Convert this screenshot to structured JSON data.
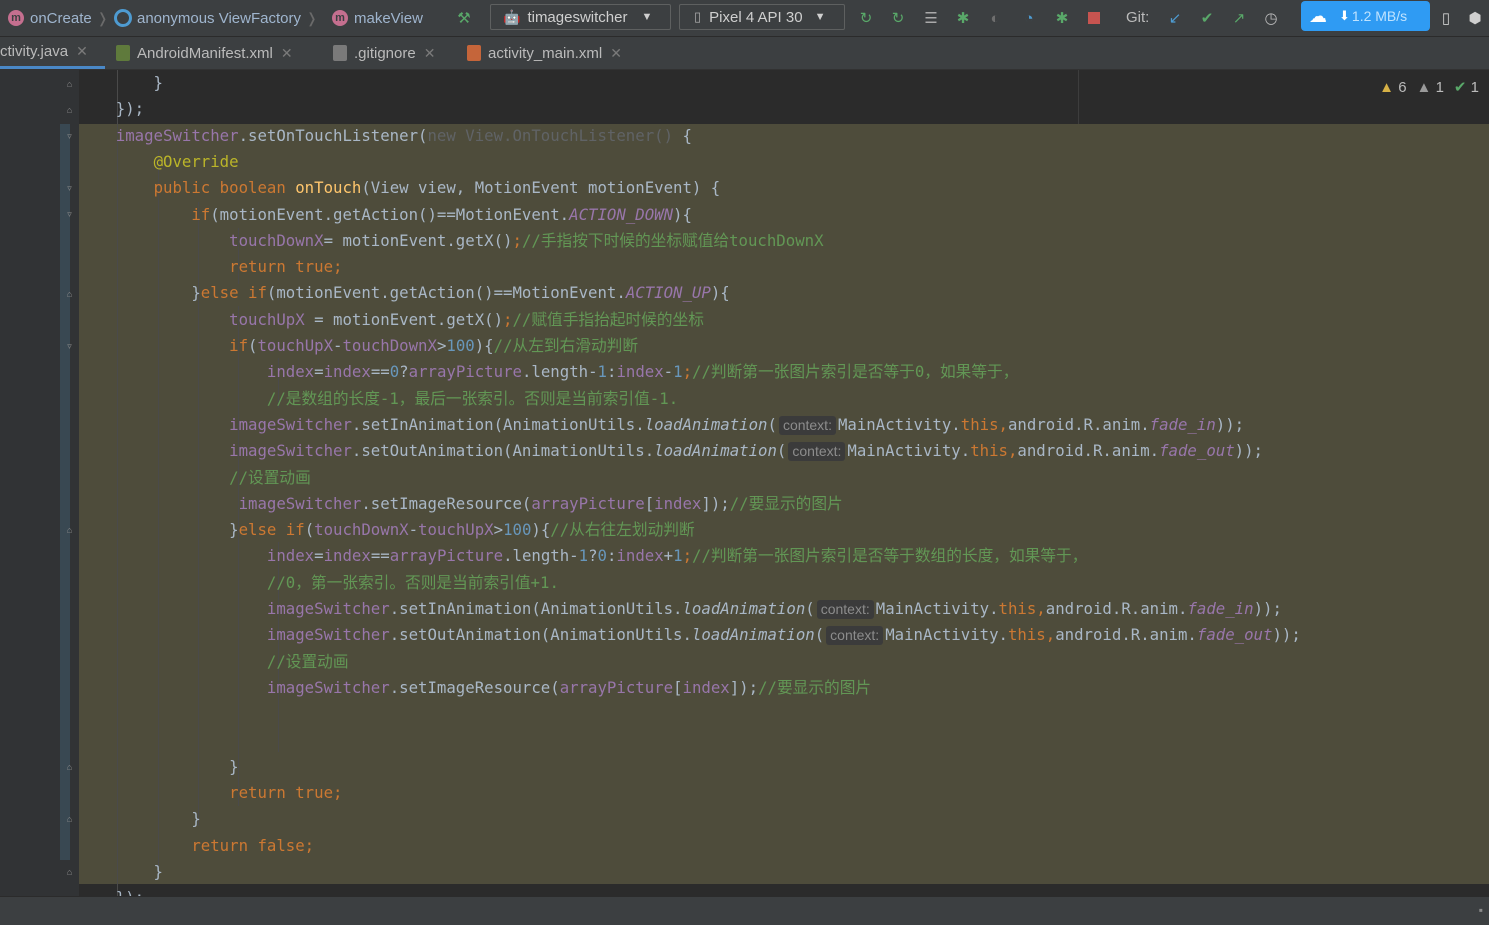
{
  "breadcrumbs": [
    {
      "badge": "m",
      "label": "onCreate"
    },
    {
      "badge": "",
      "label": "anonymous ViewFactory"
    },
    {
      "badge": "m",
      "label": "makeView"
    }
  ],
  "toolbar": {
    "run_config": "timageswitcher",
    "device": "Pixel 4 API 30",
    "git_label": "Git:",
    "net_speed": "1.2 MB/s"
  },
  "tabs": [
    {
      "label": "ctivity.java",
      "active": true
    },
    {
      "label": "AndroidManifest.xml",
      "active": false
    },
    {
      "label": ".gitignore",
      "active": false
    },
    {
      "label": "activity_main.xml",
      "active": false
    }
  ],
  "inspections": {
    "warnings": "6",
    "weak_warnings": "1",
    "typos": "1"
  },
  "hint_label": "context:",
  "code": [
    [
      "        }"
    ],
    [
      "    });"
    ],
    [
      "    imageSwitcher",
      ".setOnTouchListener(",
      "new View.OnTouchListener()",
      " {"
    ],
    [
      "        ",
      "@Override"
    ],
    [
      "        ",
      "public boolean ",
      "onTouch",
      "(View view, MotionEvent motionEvent) {"
    ],
    [
      "            ",
      "if",
      "(motionEvent.getAction()==MotionEvent.",
      "ACTION_DOWN",
      "){"
    ],
    [
      "                ",
      "touchDownX",
      "= motionEvent.getX()",
      ";",
      "//手指按下时候的坐标赋值给touchDownX"
    ],
    [
      "                ",
      "return true;"
    ],
    [
      "            }",
      "else if",
      "(motionEvent.getAction()==MotionEvent.",
      "ACTION_UP",
      "){"
    ],
    [
      "                ",
      "touchUpX",
      " = motionEvent.getX()",
      ";",
      "//赋值手指抬起时候的坐标"
    ],
    [
      "                ",
      "if",
      "(",
      "touchUpX",
      "-",
      "touchDownX",
      ">",
      "100",
      "){",
      "//从左到右滑动判断"
    ],
    [
      "                    ",
      "index",
      "=",
      "index",
      "==",
      "0",
      "?",
      "arrayPicture",
      ".length-",
      "1",
      ":",
      "index",
      "-",
      "1",
      ";",
      "//判断第一张图片索引是否等于0，如果等于，"
    ],
    [
      "                    ",
      "//是数组的长度-1，最后一张索引。否则是当前索引值-1."
    ],
    [
      "                ",
      "imageSwitcher",
      ".setInAnimation(AnimationUtils.",
      "loadAnimation",
      "(",
      "MainActivity.",
      "this,",
      "android.R.anim.",
      "fade_in",
      "));"
    ],
    [
      "                ",
      "imageSwitcher",
      ".setOutAnimation(AnimationUtils.",
      "loadAnimation",
      "(",
      "MainActivity.",
      "this,",
      "android.R.anim.",
      "fade_out",
      "));"
    ],
    [
      "                ",
      "//设置动画"
    ],
    [
      "                 ",
      "imageSwitcher",
      ".setImageResource(",
      "arrayPicture",
      "[",
      "index",
      "]);",
      "//要显示的图片"
    ],
    [
      "                }",
      "else if",
      "(",
      "touchDownX",
      "-",
      "touchUpX",
      ">",
      "100",
      "){",
      "//从右往左划动判断"
    ],
    [
      "                    ",
      "index",
      "=",
      "index",
      "==",
      "arrayPicture",
      ".length-",
      "1",
      "?",
      "0",
      ":",
      "index",
      "+",
      "1",
      ";",
      "//判断第一张图片索引是否等于数组的长度，如果等于，"
    ],
    [
      "                    ",
      "//0，第一张索引。否则是当前索引值+1."
    ],
    [
      "                    ",
      "imageSwitcher",
      ".setInAnimation(AnimationUtils.",
      "loadAnimation",
      "(",
      "MainActivity.",
      "this,",
      "android.R.anim.",
      "fade_in",
      "));"
    ],
    [
      "                    ",
      "imageSwitcher",
      ".setOutAnimation(AnimationUtils.",
      "loadAnimation",
      "(",
      "MainActivity.",
      "this,",
      "android.R.anim.",
      "fade_out",
      "));"
    ],
    [
      "                    ",
      "//设置动画"
    ],
    [
      "                    ",
      "imageSwitcher",
      ".setImageResource(",
      "arrayPicture",
      "[",
      "index",
      "]);",
      "//要显示的图片"
    ],
    [
      ""
    ],
    [
      ""
    ],
    [
      "                }"
    ],
    [
      "                ",
      "return true;"
    ],
    [
      "            }"
    ],
    [
      "            ",
      "return false;"
    ],
    [
      "        }"
    ],
    [
      "    });"
    ]
  ],
  "code_styles": [
    [
      "p"
    ],
    [
      "p"
    ],
    [
      "fld",
      "p",
      "dim",
      "p"
    ],
    [
      "p",
      "ann"
    ],
    [
      "p",
      "kw",
      "mth",
      "p"
    ],
    [
      "p",
      "kw",
      "p",
      "fldi",
      "p"
    ],
    [
      "p",
      "fld",
      "p",
      "kw",
      "cmt"
    ],
    [
      "p",
      "kw"
    ],
    [
      "p",
      "kw",
      "p",
      "fldi",
      "p"
    ],
    [
      "p",
      "fld",
      "p",
      "kw",
      "cmt"
    ],
    [
      "p",
      "kw",
      "p",
      "fld",
      "p",
      "fld",
      "p",
      "num",
      "p",
      "cmt"
    ],
    [
      "p",
      "fld",
      "p",
      "fld",
      "p",
      "num",
      "p",
      "fld",
      "p",
      "num",
      "p",
      "fld",
      "p",
      "num",
      "kw",
      "cmt"
    ],
    [
      "p",
      "cmt"
    ],
    [
      "p",
      "fld",
      "p",
      "sit",
      "p",
      "p",
      "kw",
      "p",
      "fldi",
      "p"
    ],
    [
      "p",
      "fld",
      "p",
      "sit",
      "p",
      "p",
      "kw",
      "p",
      "fldi",
      "p"
    ],
    [
      "p",
      "cmt"
    ],
    [
      "p",
      "fld",
      "p",
      "fld",
      "p",
      "fld",
      "p",
      "cmt"
    ],
    [
      "p",
      "kw",
      "p",
      "fld",
      "p",
      "fld",
      "p",
      "num",
      "p",
      "cmt"
    ],
    [
      "p",
      "fld",
      "p",
      "fld",
      "p",
      "fld",
      "p",
      "num",
      "p",
      "num",
      "p",
      "fld",
      "p",
      "num",
      "kw",
      "cmt"
    ],
    [
      "p",
      "cmt"
    ],
    [
      "p",
      "fld",
      "p",
      "sit",
      "p",
      "p",
      "kw",
      "p",
      "fldi",
      "p"
    ],
    [
      "p",
      "fld",
      "p",
      "sit",
      "p",
      "p",
      "kw",
      "p",
      "fldi",
      "p"
    ],
    [
      "p",
      "cmt"
    ],
    [
      "p",
      "fld",
      "p",
      "fld",
      "p",
      "fld",
      "p",
      "cmt"
    ],
    [
      "p"
    ],
    [
      "p"
    ],
    [
      "p"
    ],
    [
      "p",
      "kw"
    ],
    [
      "p"
    ],
    [
      "p",
      "kw"
    ],
    [
      "p"
    ],
    [
      "p"
    ]
  ],
  "colors": {
    "editor_bg": "#2b2b2b",
    "scope_highlight": "#4e4c3b",
    "keyword": "#cc7832",
    "field": "#9876aa",
    "method": "#ffc66d",
    "comment": "#629755",
    "number": "#6897bb",
    "annotation": "#bbb529",
    "accent": "#4a88c7"
  }
}
